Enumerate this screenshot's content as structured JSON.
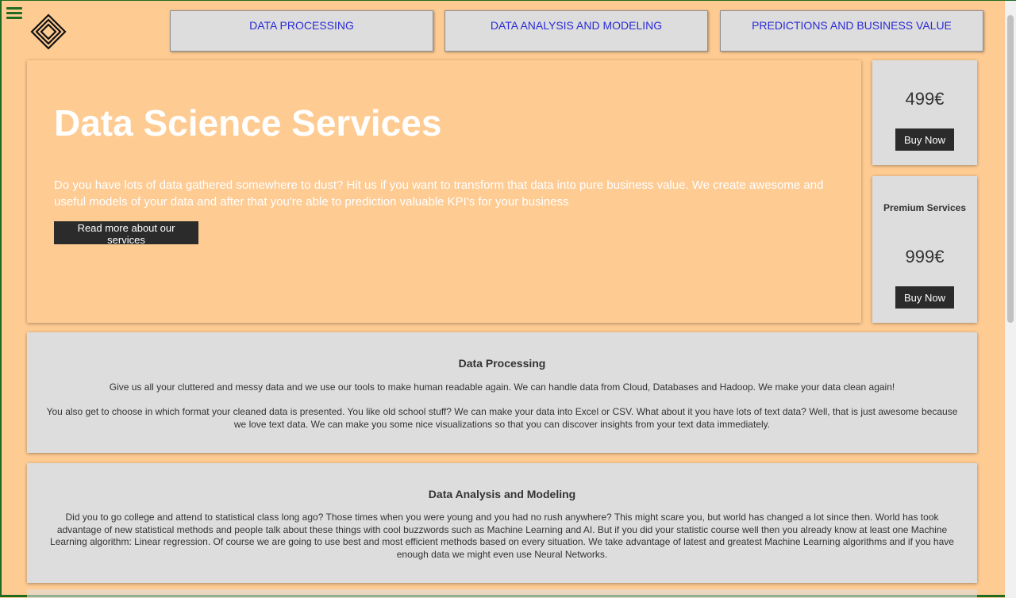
{
  "nav": {
    "items": [
      {
        "label": "DATA PROCESSING"
      },
      {
        "label": "DATA ANALYSIS AND MODELING"
      },
      {
        "label": "PREDICTIONS AND BUSINESS VALUE"
      }
    ]
  },
  "hero": {
    "title": "Data Science Services",
    "text": "Do you have lots of data gathered somewhere to dust? Hit us if you want to transform that data into pure business value. We create awesome and useful models of your data and after that you're able to prediction valuable KPI's for your business",
    "button_label": "Read more about our services"
  },
  "pricing": [
    {
      "label": "",
      "price": "499€",
      "button_label": "Buy Now"
    },
    {
      "label": "Premium Services",
      "price": "999€",
      "button_label": "Buy Now"
    }
  ],
  "sections": [
    {
      "title": "Data Processing",
      "paragraphs": [
        "Give us all your cluttered and messy data and we use our tools to make human readable again. We can handle data from Cloud, Databases and Hadoop. We make your data clean again!",
        "You also get to choose in which format your cleaned data is presented. You like old school stuff? We can make your data into Excel or CSV. What about it you have lots of text data? Well, that is just awesome because we love text data. We can make you some nice visualizations so that you can discover insights from your text data immediately."
      ]
    },
    {
      "title": "Data Analysis and Modeling",
      "paragraphs": [
        "Did you to go college and attend to statistical class long ago? Those times when you were young and you had no rush anywhere? This might scare you, but world has changed a lot since then. World has took advantage of new statistical methods and people talk about these things with cool buzzwords such as Machine Learning and AI. But if you did your statistic course well then you already know at least one Machine Learning algorithm: Linear regression. Of course we are going to use best and most efficient methods based on every situation. We take advantage of latest and greatest Machine Learning algorithms and if you have enough data we might even use Neural Networks."
      ]
    }
  ],
  "colors": {
    "background": "#fecb93",
    "card": "#dddddd",
    "nav_text": "#2b2bd6",
    "button": "#2b2b2b",
    "menu_icon": "#1f6b1f"
  },
  "icons": {
    "menu": "hamburger-menu-icon",
    "logo": "diamond-logo-icon"
  }
}
